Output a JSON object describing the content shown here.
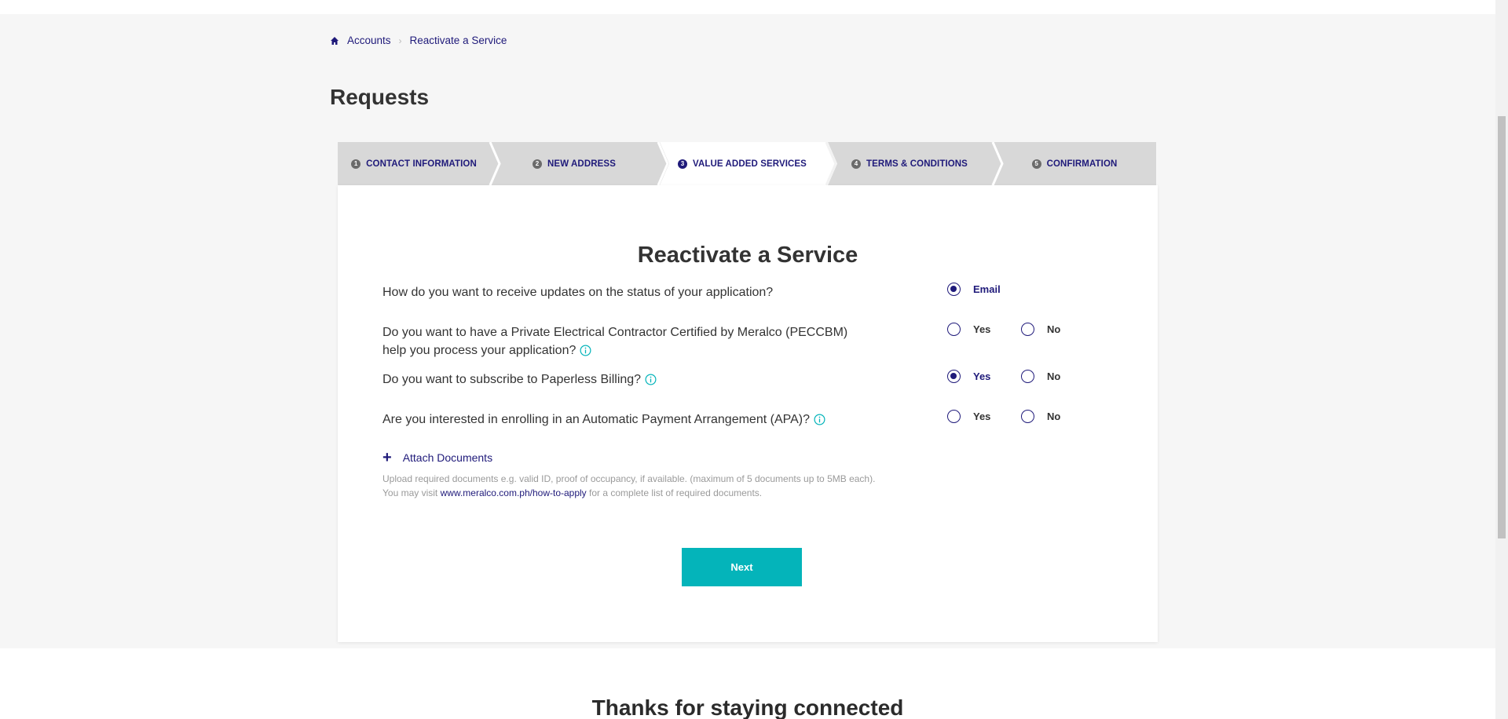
{
  "breadcrumb": {
    "items": [
      "Accounts",
      "Reactivate a Service"
    ]
  },
  "page_title": "Requests",
  "stepper": {
    "steps": [
      {
        "num": "1",
        "label": "CONTACT INFORMATION"
      },
      {
        "num": "2",
        "label": "NEW ADDRESS"
      },
      {
        "num": "3",
        "label": "VALUE ADDED SERVICES"
      },
      {
        "num": "4",
        "label": "TERMS & CONDITIONS"
      },
      {
        "num": "5",
        "label": "CONFIRMATION"
      }
    ],
    "active_index": 2
  },
  "form": {
    "title": "Reactivate a Service",
    "questions": [
      {
        "text": "How do you want to receive updates on the status of your application?",
        "options": [
          "Email"
        ],
        "selected": "Email"
      },
      {
        "text_line1": "Do you want to have a Private Electrical Contractor Certified by Meralco (PECCBM)",
        "text_line2": "help you process your application?",
        "options": [
          "Yes",
          "No"
        ],
        "selected": null
      },
      {
        "text": "Do you want to subscribe to Paperless Billing?",
        "options": [
          "Yes",
          "No"
        ],
        "selected": "Yes"
      },
      {
        "text": "Are you interested in enrolling in an Automatic Payment Arrangement (APA)?",
        "options": [
          "Yes",
          "No"
        ],
        "selected": null
      }
    ],
    "attach_label": "Attach Documents",
    "hint_line1": "Upload required documents e.g. valid ID, proof of occupancy, if available. (maximum of 5 documents up to 5MB each).",
    "hint_line2_prefix": "You may visit",
    "hint_link": "www.meralco.com.ph/how-to-apply",
    "hint_line2_suffix": "for a complete list of required documents.",
    "next_label": "Next"
  },
  "footer": {
    "title": "Thanks for staying connected"
  },
  "colors": {
    "brand_navy": "#1f1a7a",
    "accent_teal": "#04b4ba",
    "step_gray": "#d8d8d8"
  }
}
